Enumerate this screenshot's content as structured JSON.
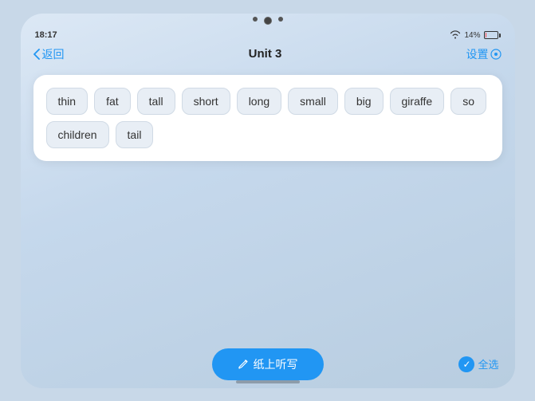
{
  "statusBar": {
    "time": "18:17",
    "wifi": "▾",
    "battery": "14%"
  },
  "nav": {
    "backLabel": "返回",
    "title": "Unit 3",
    "settingsLabel": "设置"
  },
  "wordRows": [
    [
      "thin",
      "fat",
      "tall",
      "short",
      "long",
      "small",
      "big",
      "giraffe",
      "so"
    ],
    [
      "children",
      "tail"
    ]
  ],
  "bottomBar": {
    "writeLabel": "纸上听写",
    "selectAllLabel": "全选"
  }
}
